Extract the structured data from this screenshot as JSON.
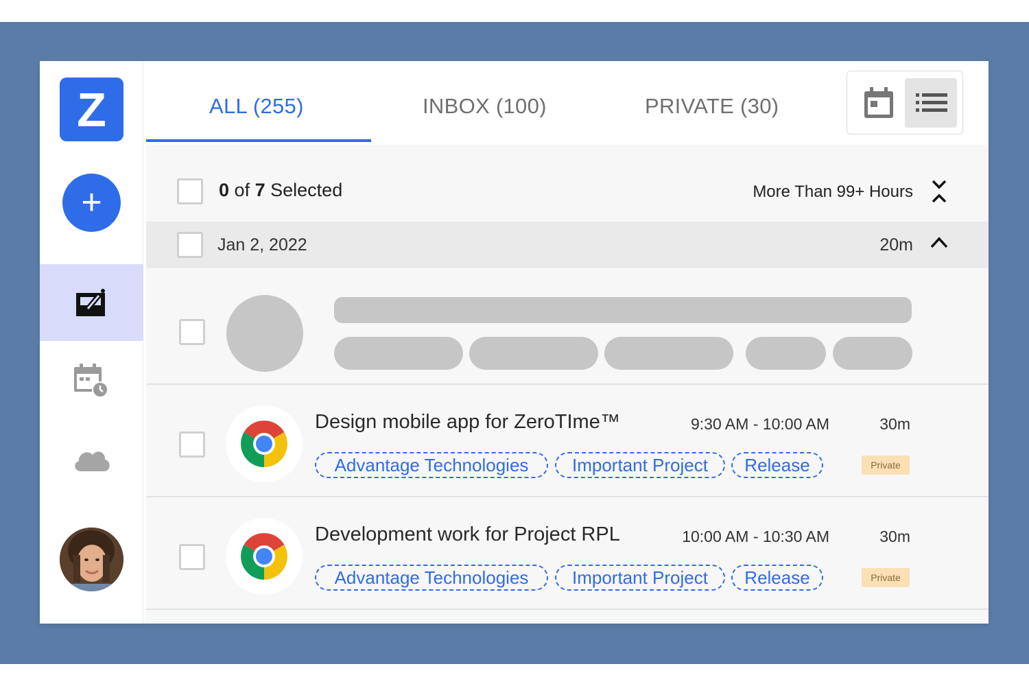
{
  "sidebar": {
    "logo_letter": "Z",
    "add_label": "+",
    "nav": [
      {
        "icon": "edit-note-icon",
        "active": true
      },
      {
        "icon": "calendar-clock-icon",
        "active": false
      },
      {
        "icon": "cloud-icon",
        "active": false
      }
    ],
    "avatar": "user-avatar"
  },
  "tabs": [
    {
      "label": "ALL (255)",
      "active": true
    },
    {
      "label": "INBOX (100)",
      "active": false
    },
    {
      "label": "PRIVATE (30)",
      "active": false
    }
  ],
  "view_toggle": {
    "options": [
      "calendar-icon",
      "list-icon"
    ],
    "selected": "list-icon"
  },
  "selection": {
    "count": "0",
    "of_word": "of",
    "total": "7",
    "suffix": "Selected",
    "filter_label": "More Than 99+ Hours"
  },
  "date_group": {
    "date": "Jan 2, 2022",
    "duration": "20m"
  },
  "events": [
    {
      "title": "Design mobile app for ZeroTIme™",
      "time": "9:30 AM - 10:00 AM",
      "duration": "30m",
      "tags": [
        "Advantage Technologies",
        "Important Project",
        "Release"
      ],
      "badge": "Private"
    },
    {
      "title": "Development work for Project RPL",
      "time": "10:00 AM - 10:30 AM",
      "duration": "30m",
      "tags": [
        "Advantage Technologies",
        "Important Project",
        "Release"
      ],
      "badge": "Private"
    }
  ],
  "colors": {
    "brand": "#2f6ce8",
    "frame": "#5b7ca6",
    "active_nav": "#d8dcfa",
    "skeleton": "#c6c6c6",
    "private_badge": "#fbe0b6"
  }
}
